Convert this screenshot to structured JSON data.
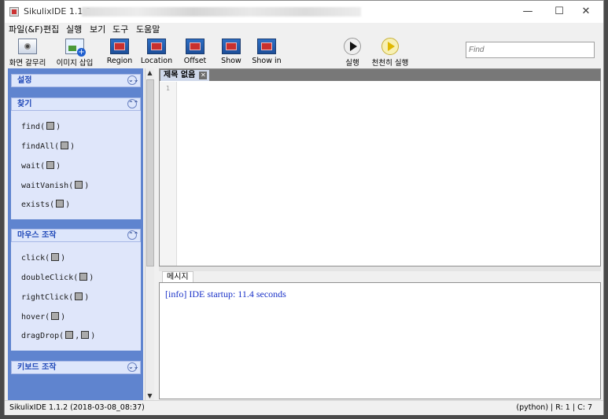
{
  "window": {
    "title": "SikulixIDE 1.1.2 -",
    "minimize_glyph": "—",
    "maximize_glyph": "☐",
    "close_glyph": "✕"
  },
  "menubar": [
    "파일(&F)",
    "편집",
    "실행",
    "보기",
    "도구",
    "도움말"
  ],
  "toolbar": {
    "screenshot_label": "화면 갈무리",
    "insert_image_label": "이미지 삽입",
    "region_label": "Region",
    "location_label": "Location",
    "offset_label": "Offset",
    "show_label": "Show",
    "show_in_label": "Show in",
    "run_label": "실행",
    "run_slow_label": "천천히 실행",
    "find_placeholder": "Find"
  },
  "sidebar": {
    "settings": {
      "title": "설정",
      "chevron": "⌄⌄"
    },
    "find": {
      "title": "찾기",
      "chevron": "⌃⌃",
      "commands": [
        "find(",
        "findAll(",
        "wait(",
        "waitVanish(",
        "exists("
      ]
    },
    "mouse": {
      "title": "마우스 조작",
      "chevron": "⌃⌃",
      "commands": [
        "click(",
        "doubleClick(",
        "rightClick(",
        "hover(",
        "dragDrop("
      ]
    },
    "keyboard": {
      "title": "키보드 조작",
      "chevron": "⌄⌄"
    }
  },
  "editor": {
    "tab_title": "제목 없음",
    "tab_close": "✕",
    "line_number": "1"
  },
  "messages": {
    "tab_label": "메시지",
    "log_line": "[info] IDE startup: 11.4 seconds"
  },
  "statusbar": {
    "left": "SikulixIDE 1.1.2 (2018-03-08_08:37)",
    "right": "(python) | R: 1 | C: 7"
  }
}
